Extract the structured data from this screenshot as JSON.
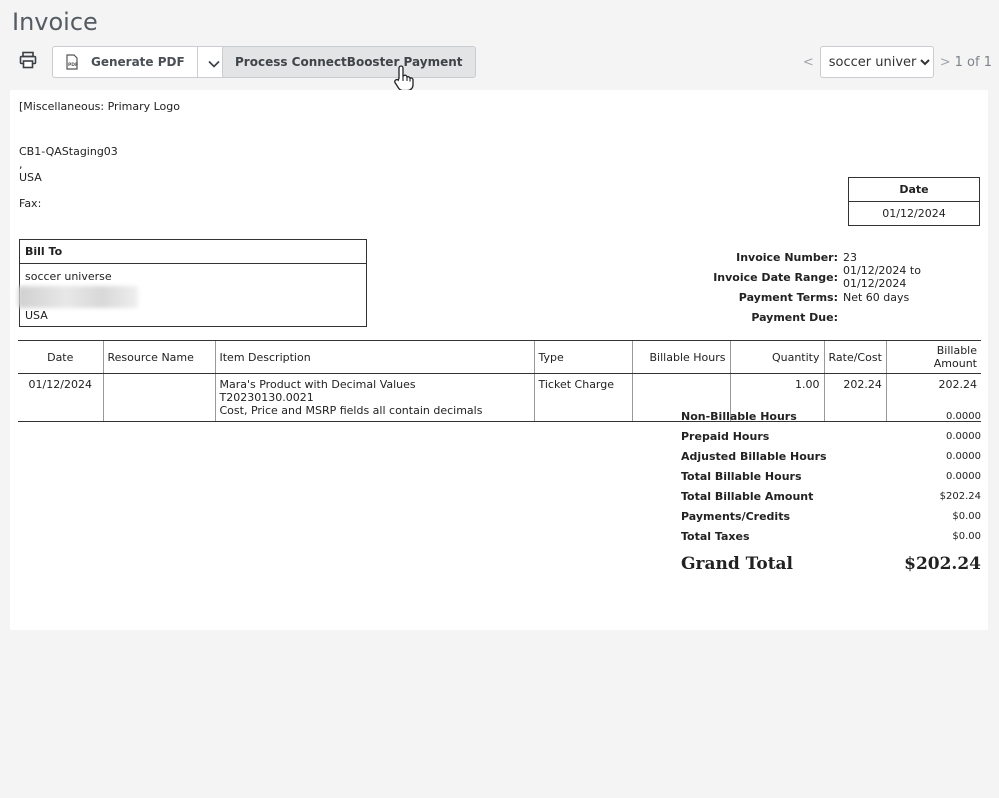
{
  "page": {
    "title": "Invoice"
  },
  "toolbar": {
    "print_icon": "printer-icon",
    "generate_pdf_label": "Generate PDF",
    "pdf_icon": "pdf-file-icon",
    "dropdown_icon": "chevron-down-icon",
    "process_payment_label": "Process ConnectBooster Payment",
    "pager": {
      "prev": "<",
      "next": ">",
      "selected_account": "soccer universe",
      "count_text": "1 of 1"
    }
  },
  "invoice": {
    "logo_placeholder": "[Miscellaneous: Primary Logo",
    "company": {
      "name": "CB1-QAStaging03",
      "comma": ",",
      "country": "USA",
      "fax_label": "Fax:"
    },
    "date_box": {
      "header": "Date",
      "value": "01/12/2024"
    },
    "bill_to": {
      "header": "Bill To",
      "name": "soccer universe",
      "country": "USA"
    },
    "meta": [
      {
        "label": "Invoice Number:",
        "value": "23"
      },
      {
        "label": "Invoice Date Range:",
        "value": "01/12/2024 to 01/12/2024"
      },
      {
        "label": "Payment Terms:",
        "value": "Net 60 days"
      },
      {
        "label": "Payment Due:",
        "value": ""
      }
    ],
    "columns": [
      "Date",
      "Resource Name",
      "Item Description",
      "Type",
      "Billable Hours",
      "Quantity",
      "Rate/Cost",
      "Billable Amount"
    ],
    "rows": [
      {
        "date": "01/12/2024",
        "resource": "",
        "description": [
          "Mara's Product with Decimal Values",
          "T20230130.0021",
          "Cost, Price and MSRP fields all contain decimals"
        ],
        "type": "Ticket Charge",
        "billable_hours": "",
        "quantity": "1.00",
        "rate": "202.24",
        "amount": "202.24"
      }
    ],
    "totals": [
      {
        "label": "Non-Billable Hours",
        "value": "0.0000"
      },
      {
        "label": "Prepaid Hours",
        "value": "0.0000"
      },
      {
        "label": "Adjusted Billable Hours",
        "value": "0.0000"
      },
      {
        "label": "Total Billable Hours",
        "value": "0.0000"
      },
      {
        "label": "Total Billable Amount",
        "value": "$202.24"
      },
      {
        "label": "Payments/Credits",
        "value": "$0.00"
      },
      {
        "label": "Total Taxes",
        "value": "$0.00"
      }
    ],
    "grand_total": {
      "label": "Grand Total",
      "value": "$202.24"
    }
  }
}
